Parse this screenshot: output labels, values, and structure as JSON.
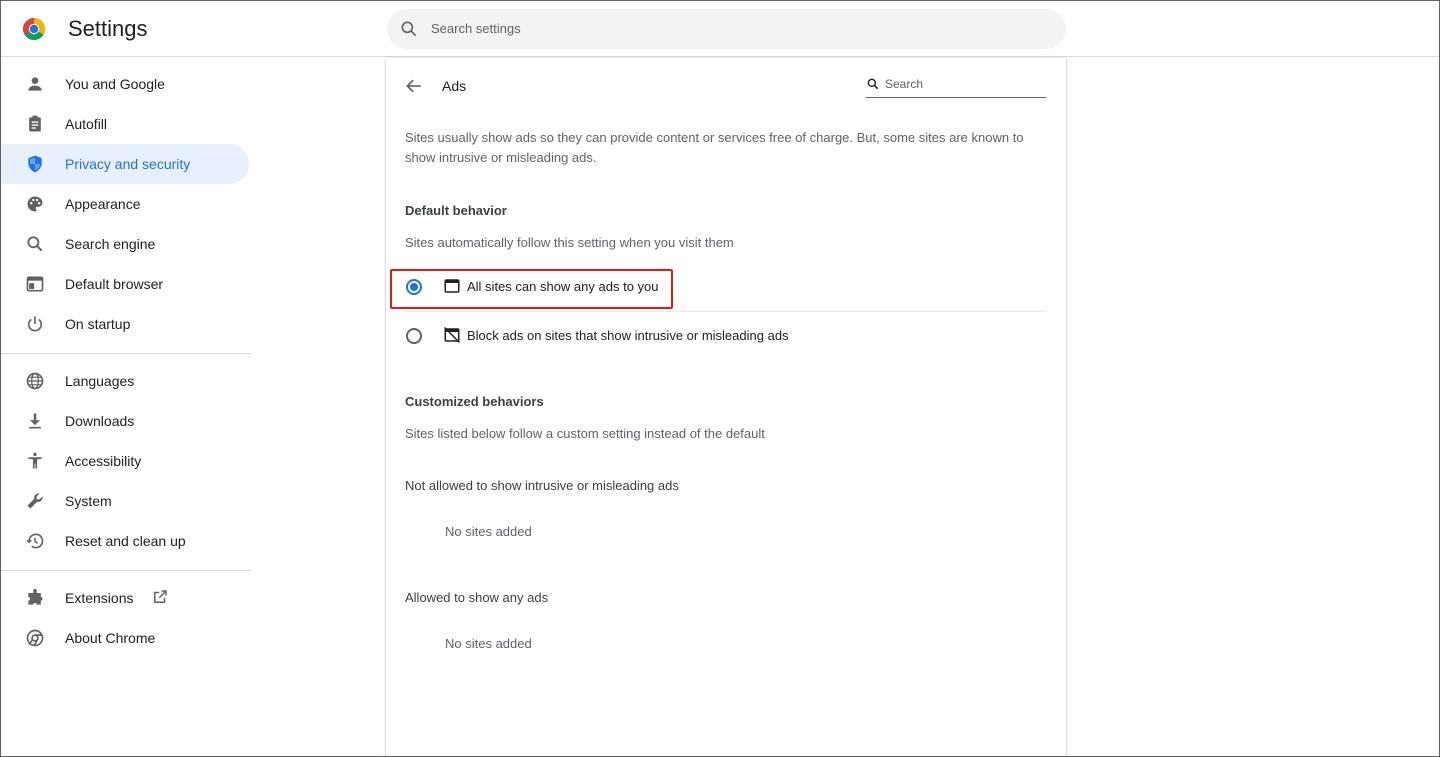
{
  "header": {
    "title": "Settings",
    "search_placeholder": "Search settings"
  },
  "sidebar": {
    "items": [
      {
        "label": "You and Google",
        "icon": "person-icon"
      },
      {
        "label": "Autofill",
        "icon": "clipboard-icon"
      },
      {
        "label": "Privacy and security",
        "icon": "shield-icon",
        "active": true
      },
      {
        "label": "Appearance",
        "icon": "palette-icon"
      },
      {
        "label": "Search engine",
        "icon": "search-icon"
      },
      {
        "label": "Default browser",
        "icon": "browser-window-icon"
      },
      {
        "label": "On startup",
        "icon": "power-icon"
      },
      {
        "label": "Languages",
        "icon": "globe-icon"
      },
      {
        "label": "Downloads",
        "icon": "download-icon"
      },
      {
        "label": "Accessibility",
        "icon": "accessibility-icon"
      },
      {
        "label": "System",
        "icon": "wrench-icon"
      },
      {
        "label": "Reset and clean up",
        "icon": "restore-icon"
      },
      {
        "label": "Extensions",
        "icon": "puzzle-icon"
      },
      {
        "label": "About Chrome",
        "icon": "chrome-icon"
      }
    ]
  },
  "main": {
    "title": "Ads",
    "search_label": "Search",
    "description": "Sites usually show ads so they can provide content or services free of charge. But, some sites are known to show intrusive or misleading ads.",
    "default_behavior": {
      "heading": "Default behavior",
      "subtitle": "Sites automatically follow this setting when you visit them",
      "options": [
        {
          "label": "All sites can show any ads to you",
          "checked": true
        },
        {
          "label": "Block ads on sites that show intrusive or misleading ads",
          "checked": false
        }
      ]
    },
    "customized": {
      "heading": "Customized behaviors",
      "subtitle": "Sites listed below follow a custom setting instead of the default",
      "not_allowed": {
        "heading": "Not allowed to show intrusive or misleading ads",
        "empty": "No sites added"
      },
      "allowed": {
        "heading": "Allowed to show any ads",
        "empty": "No sites added"
      }
    }
  },
  "colors": {
    "accent": "#1a73e8",
    "active_bg": "#e8f0fe",
    "highlight_box": "#e0191a"
  }
}
